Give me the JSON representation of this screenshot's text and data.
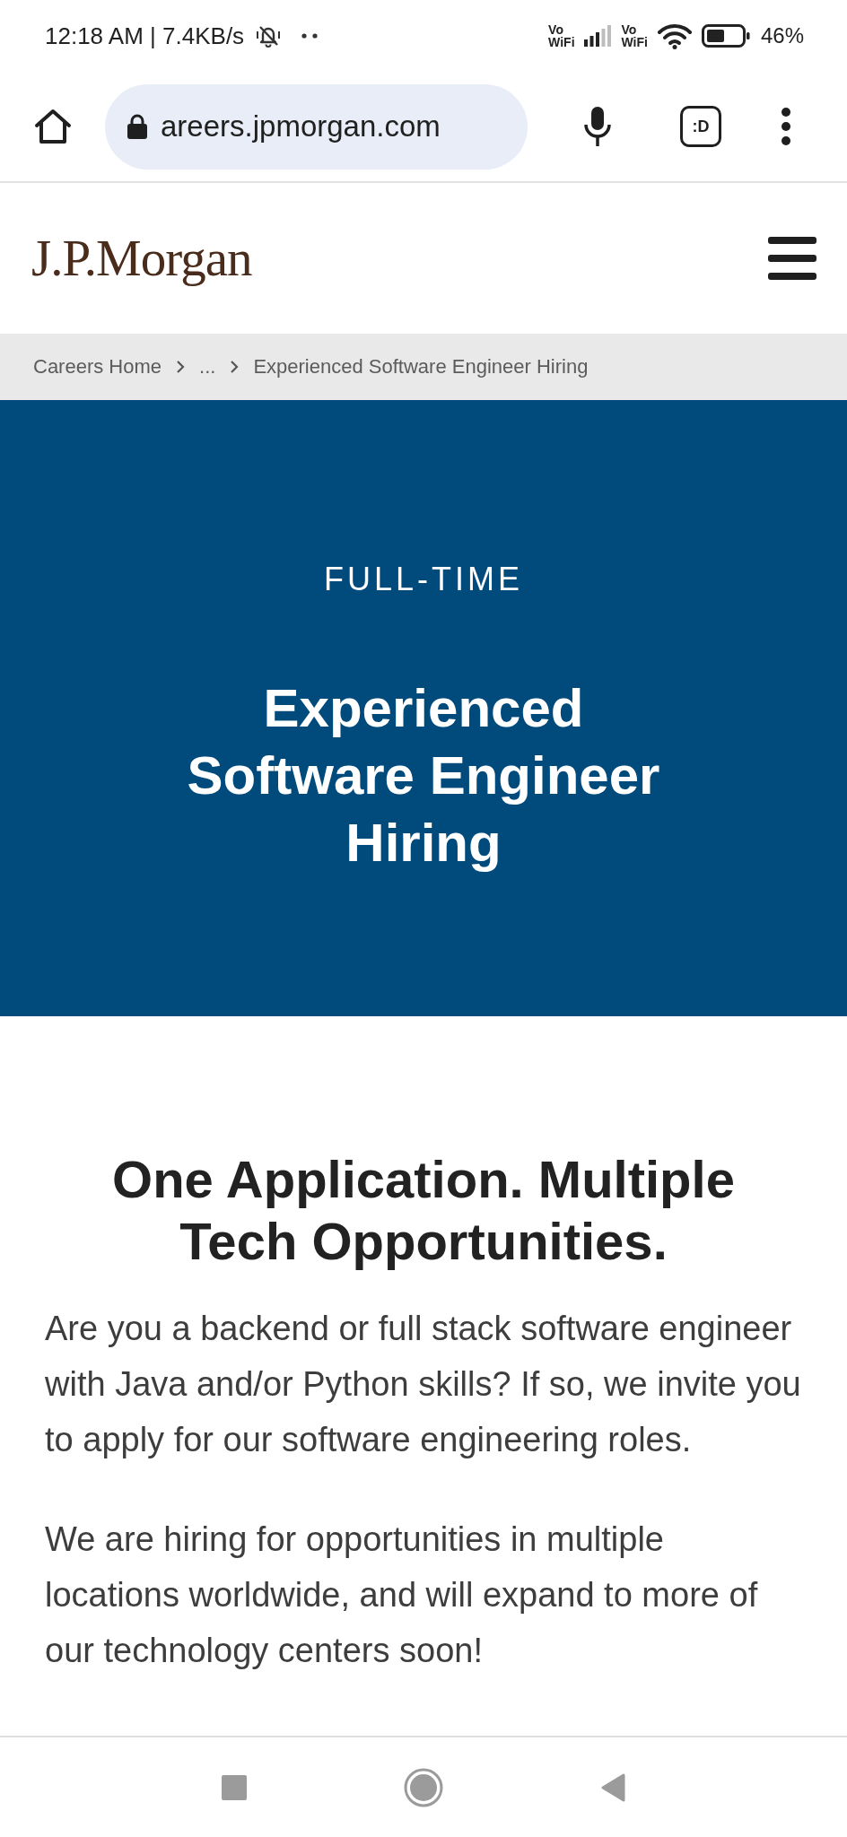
{
  "status_bar": {
    "clock_speed": "12:18 AM | 7.4KB/s",
    "vowifi": [
      {
        "top": "Vo",
        "bottom": "WiFi"
      },
      {
        "top": "Vo",
        "bottom": "WiFi"
      }
    ],
    "battery": "46%"
  },
  "browser_bar": {
    "url": "areers.jpmorgan.com",
    "tab_count": ":D"
  },
  "site_header": {
    "logo": "J.P.Morgan"
  },
  "breadcrumb": [
    {
      "label": "Careers Home"
    },
    {
      "label": "..."
    },
    {
      "label": "Experienced Software Engineer Hiring"
    }
  ],
  "hero": {
    "eyebrow": "FULL-TIME",
    "title": "Experienced Software Engineer Hiring"
  },
  "content": {
    "heading": "One Application. Multiple Tech Opportunities.",
    "paragraphs": [
      "Are you a backend or full stack software engineer with Java and/or Python skills? If so, we invite you to apply for our software engineering roles.",
      "We are hiring for opportunities in multiple locations worldwide, and will expand to more of our technology centers soon!"
    ]
  }
}
